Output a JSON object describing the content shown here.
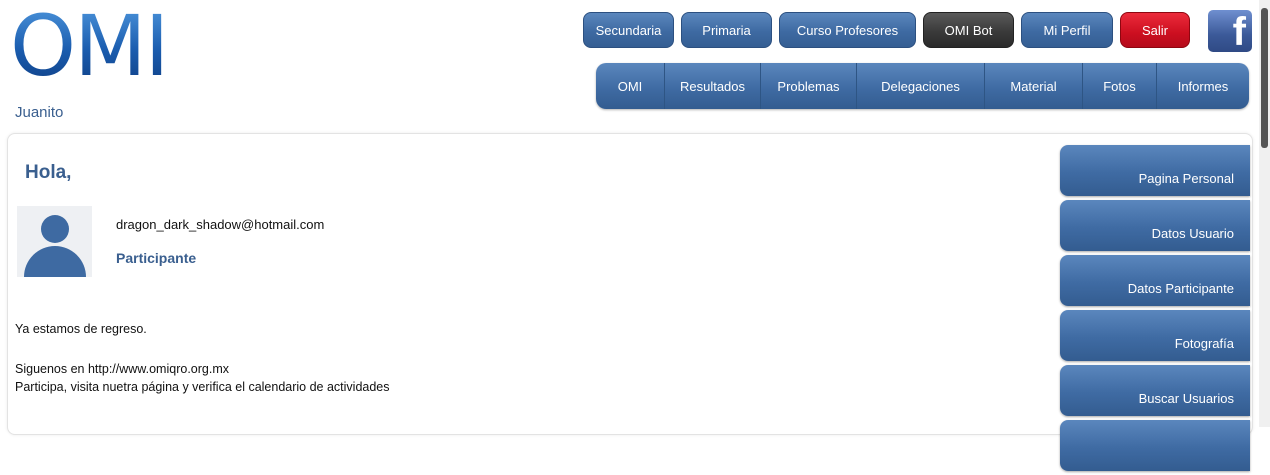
{
  "header": {
    "logo_text": "OMI",
    "username": "Juanito",
    "top_buttons": [
      {
        "label": "Secundaria",
        "style": "blue"
      },
      {
        "label": "Primaria",
        "style": "blue"
      },
      {
        "label": "Curso Profesores",
        "style": "blue"
      },
      {
        "label": "OMI Bot",
        "style": "dark"
      },
      {
        "label": "Mi Perfil",
        "style": "blue"
      },
      {
        "label": "Salir",
        "style": "red"
      }
    ],
    "facebook_icon": "facebook-icon",
    "nav": [
      "OMI",
      "Resultados",
      "Problemas",
      "Delegaciones",
      "Material",
      "Fotos",
      "Informes"
    ]
  },
  "main": {
    "greeting": "Hola, ",
    "email": "dragon_dark_shadow@hotmail.com",
    "role": "Participante",
    "messages": [
      "Ya estamos de regreso.",
      "Siguenos en http://www.omiqro.org.mx",
      "Participa, visita nuetra página y verifica el calendario de actividades"
    ]
  },
  "side_menu": [
    "Pagina Personal",
    "Datos Usuario",
    "Datos Participante",
    "Fotografía",
    "Buscar Usuarios"
  ],
  "colors": {
    "brand_blue": "#3e6aa2",
    "logo_blue": "#1d5fb0",
    "danger_red": "#cc0f20",
    "dark_button": "#3a3a3a",
    "facebook_blue": "#3b5998"
  }
}
